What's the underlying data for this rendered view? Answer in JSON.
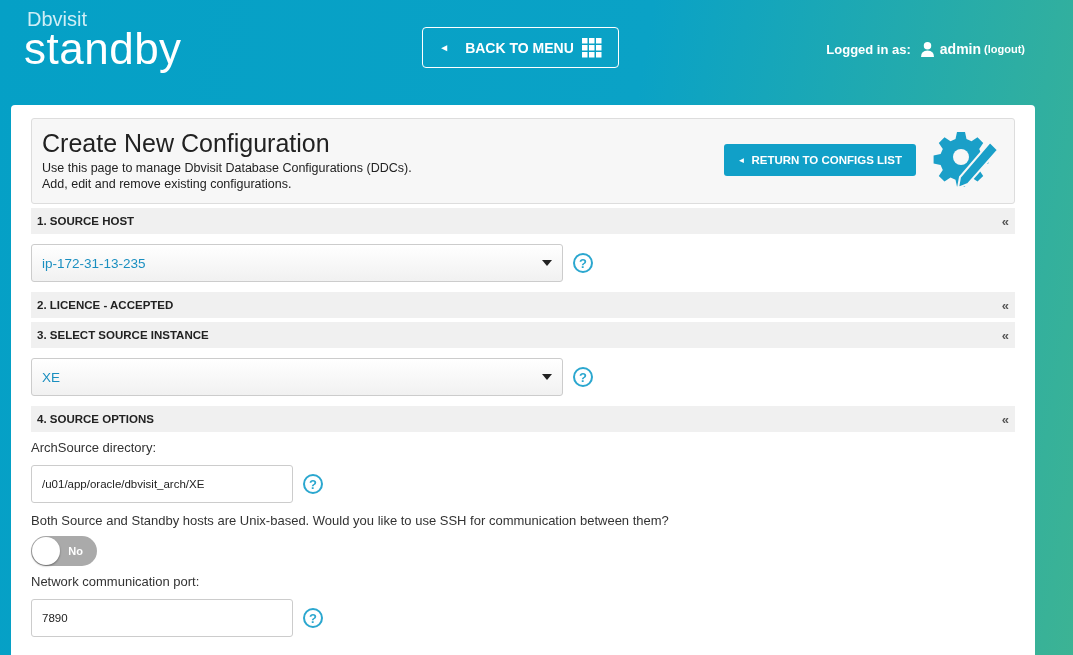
{
  "logo": {
    "brand": "Dbvisit",
    "product": "standby"
  },
  "header": {
    "back_button": {
      "arrow": "◄",
      "label": "BACK TO MENU"
    },
    "login_label": "Logged in as:",
    "user": "admin",
    "logout": "(logout)"
  },
  "intro": {
    "title": "Create New Configuration",
    "lines": [
      "Use this page to manage Dbvisit Database Configurations (DDCs).",
      "Add, edit and remove existing configurations."
    ],
    "return_button": {
      "arrow": "◄",
      "label": "RETURN TO CONFIGS LIST"
    }
  },
  "sections": [
    {
      "title": "1. SOURCE HOST",
      "toggle": "«",
      "content": [
        {
          "kind": "select",
          "value": "ip-172-31-13-235",
          "help": "?"
        }
      ]
    },
    {
      "title": "2. LICENCE - ACCEPTED",
      "toggle": "«"
    },
    {
      "title": "3. SELECT SOURCE INSTANCE",
      "toggle": "«",
      "content": [
        {
          "kind": "select",
          "value": "XE",
          "help": "?"
        }
      ]
    },
    {
      "title": "4. SOURCE OPTIONS",
      "toggle": "«",
      "content": [
        {
          "kind": "label",
          "text": "ArchSource directory:"
        },
        {
          "kind": "text_field",
          "value": "/u01/app/oracle/dbvisit_arch/XE",
          "help": "?"
        },
        {
          "kind": "label",
          "text": "Both Source and Standby hosts are Unix-based. Would you like to use SSH for communication between them?"
        },
        {
          "kind": "switch",
          "on": false,
          "text": "No"
        },
        {
          "kind": "label",
          "text": "Network communication port:"
        },
        {
          "kind": "text_field",
          "value": "7890",
          "help": "?"
        }
      ]
    }
  ]
}
